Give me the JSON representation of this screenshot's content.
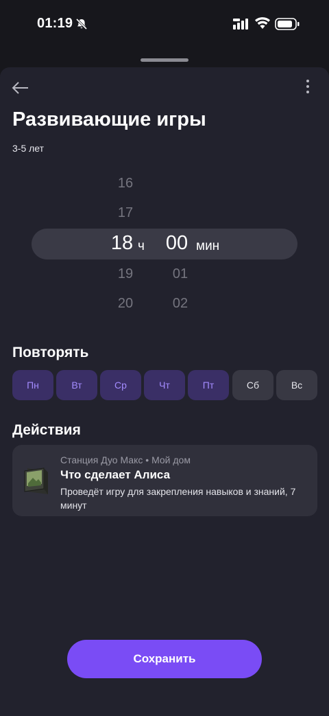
{
  "status_bar": {
    "time": "01:19"
  },
  "header": {
    "title": "Развивающие игры",
    "subtitle": "3-5 лет"
  },
  "time_picker": {
    "hours": [
      "16",
      "17",
      "18",
      "19",
      "20"
    ],
    "minutes": [
      "00",
      "01",
      "02"
    ],
    "selected_hour": "18",
    "selected_minute": "00",
    "hour_unit": "ч",
    "minute_unit": "мин"
  },
  "repeat": {
    "title": "Повторять",
    "days": [
      {
        "label": "Пн",
        "active": true
      },
      {
        "label": "Вт",
        "active": true
      },
      {
        "label": "Ср",
        "active": true
      },
      {
        "label": "Чт",
        "active": true
      },
      {
        "label": "Пт",
        "active": true
      },
      {
        "label": "Сб",
        "active": false
      },
      {
        "label": "Вс",
        "active": false
      }
    ]
  },
  "actions": {
    "title": "Действия",
    "card": {
      "device": "Станция Дуо Макс",
      "separator": "•",
      "home": "Мой дом",
      "title": "Что сделает Алиса",
      "description": "Проведёт игру для закрепления навыков и знаний, 7 минут"
    }
  },
  "footer": {
    "save_label": "Сохранить"
  },
  "colors": {
    "accent": "#7a4cf5",
    "day_active_bg": "#3a2f66",
    "day_active_text": "#a48cff",
    "sheet_bg": "#22222d"
  }
}
